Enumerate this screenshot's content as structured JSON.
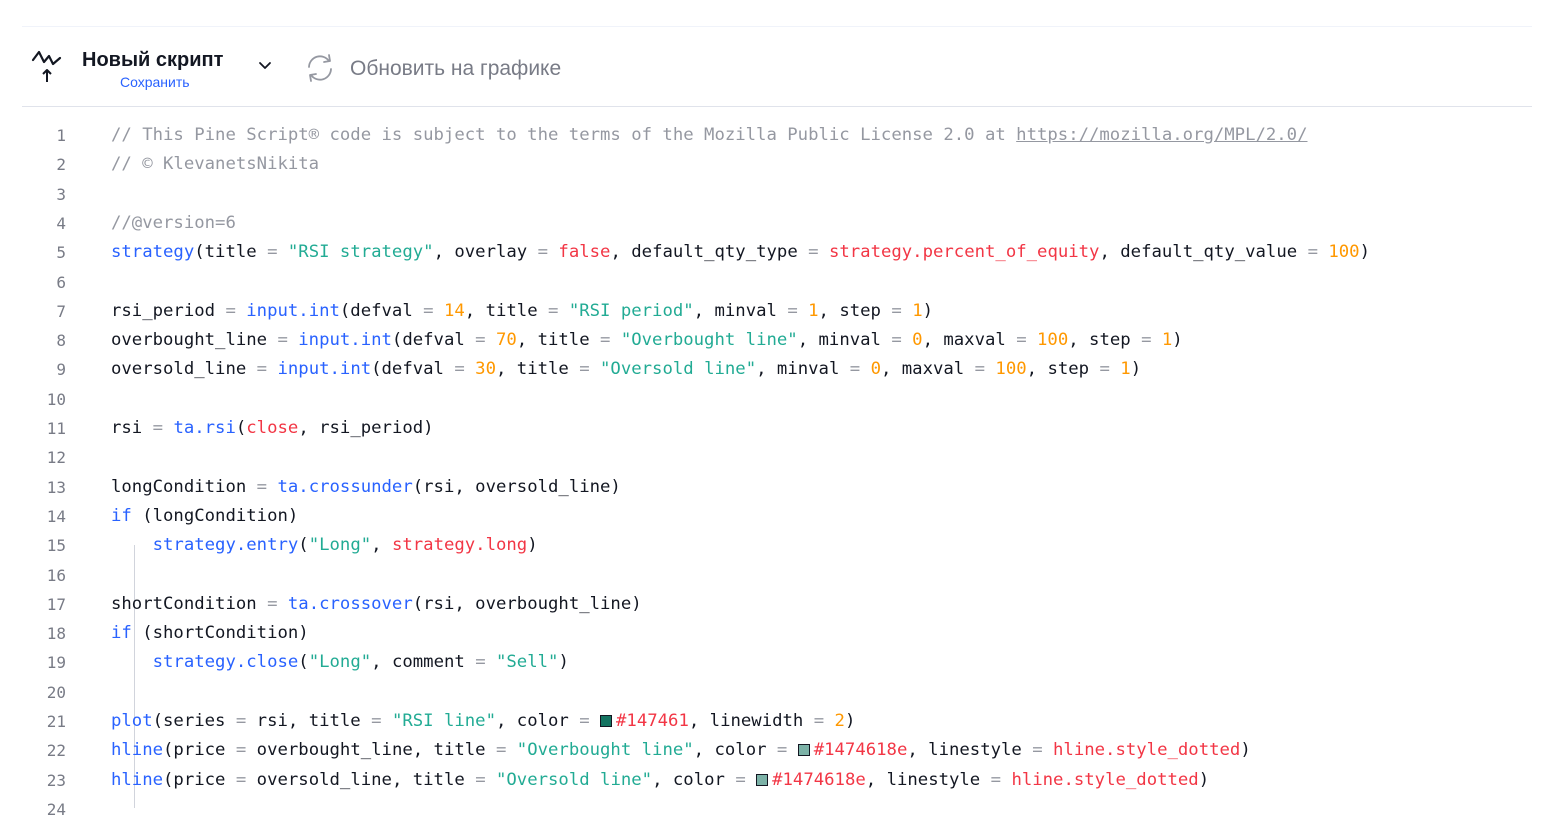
{
  "toolbar": {
    "script_title": "Новый скрипт",
    "save_label": "Сохранить",
    "update_label": "Обновить на графике"
  },
  "icons": {
    "script": "pine-script-icon",
    "dropdown": "chevron-down-icon",
    "refresh": "refresh-icon"
  },
  "colors": {
    "accent": "#2962ff",
    "comment": "#9598a1",
    "string": "#22ab94",
    "number": "#ff9800",
    "keyword": "#f23645",
    "line_color_swatch": "#147461",
    "hline_color_swatch": "#1474618e"
  },
  "editor": {
    "lines": [
      [
        [
          "c",
          "// This Pine Script® code is subject to the terms of the Mozilla Public License 2.0 at "
        ],
        [
          "u",
          "https://mozilla.org/MPL/2.0/"
        ]
      ],
      [
        [
          "c",
          "// © KlevanetsNikita"
        ]
      ],
      [],
      [
        [
          "c",
          "//@version=6"
        ]
      ],
      [
        [
          "f",
          "strategy"
        ],
        [
          "p",
          "(title "
        ],
        [
          "o",
          "="
        ],
        [
          "p",
          " "
        ],
        [
          "s",
          "\"RSI strategy\""
        ],
        [
          "p",
          ", overlay "
        ],
        [
          "o",
          "="
        ],
        [
          "p",
          " "
        ],
        [
          "k",
          "false"
        ],
        [
          "p",
          ", default_qty_type "
        ],
        [
          "o",
          "="
        ],
        [
          "p",
          " "
        ],
        [
          "k",
          "strategy.percent_of_equity"
        ],
        [
          "p",
          ", default_qty_value "
        ],
        [
          "o",
          "="
        ],
        [
          "p",
          " "
        ],
        [
          "n",
          "100"
        ],
        [
          "p",
          ")"
        ]
      ],
      [],
      [
        [
          "p",
          "rsi_period "
        ],
        [
          "o",
          "="
        ],
        [
          "p",
          " "
        ],
        [
          "f",
          "input.int"
        ],
        [
          "p",
          "(defval "
        ],
        [
          "o",
          "="
        ],
        [
          "p",
          " "
        ],
        [
          "n",
          "14"
        ],
        [
          "p",
          ", title "
        ],
        [
          "o",
          "="
        ],
        [
          "p",
          " "
        ],
        [
          "s",
          "\"RSI period\""
        ],
        [
          "p",
          ", minval "
        ],
        [
          "o",
          "="
        ],
        [
          "p",
          " "
        ],
        [
          "n",
          "1"
        ],
        [
          "p",
          ", step "
        ],
        [
          "o",
          "="
        ],
        [
          "p",
          " "
        ],
        [
          "n",
          "1"
        ],
        [
          "p",
          ")"
        ]
      ],
      [
        [
          "p",
          "overbought_line "
        ],
        [
          "o",
          "="
        ],
        [
          "p",
          " "
        ],
        [
          "f",
          "input.int"
        ],
        [
          "p",
          "(defval "
        ],
        [
          "o",
          "="
        ],
        [
          "p",
          " "
        ],
        [
          "n",
          "70"
        ],
        [
          "p",
          ", title "
        ],
        [
          "o",
          "="
        ],
        [
          "p",
          " "
        ],
        [
          "s",
          "\"Overbought line\""
        ],
        [
          "p",
          ", minval "
        ],
        [
          "o",
          "="
        ],
        [
          "p",
          " "
        ],
        [
          "n",
          "0"
        ],
        [
          "p",
          ", maxval "
        ],
        [
          "o",
          "="
        ],
        [
          "p",
          " "
        ],
        [
          "n",
          "100"
        ],
        [
          "p",
          ", step "
        ],
        [
          "o",
          "="
        ],
        [
          "p",
          " "
        ],
        [
          "n",
          "1"
        ],
        [
          "p",
          ")"
        ]
      ],
      [
        [
          "p",
          "oversold_line "
        ],
        [
          "o",
          "="
        ],
        [
          "p",
          " "
        ],
        [
          "f",
          "input.int"
        ],
        [
          "p",
          "(defval "
        ],
        [
          "o",
          "="
        ],
        [
          "p",
          " "
        ],
        [
          "n",
          "30"
        ],
        [
          "p",
          ", title "
        ],
        [
          "o",
          "="
        ],
        [
          "p",
          " "
        ],
        [
          "s",
          "\"Oversold line\""
        ],
        [
          "p",
          ", minval "
        ],
        [
          "o",
          "="
        ],
        [
          "p",
          " "
        ],
        [
          "n",
          "0"
        ],
        [
          "p",
          ", maxval "
        ],
        [
          "o",
          "="
        ],
        [
          "p",
          " "
        ],
        [
          "n",
          "100"
        ],
        [
          "p",
          ", step "
        ],
        [
          "o",
          "="
        ],
        [
          "p",
          " "
        ],
        [
          "n",
          "1"
        ],
        [
          "p",
          ")"
        ]
      ],
      [],
      [
        [
          "p",
          "rsi "
        ],
        [
          "o",
          "="
        ],
        [
          "p",
          " "
        ],
        [
          "f",
          "ta.rsi"
        ],
        [
          "p",
          "("
        ],
        [
          "k",
          "close"
        ],
        [
          "p",
          ", rsi_period)"
        ]
      ],
      [],
      [
        [
          "p",
          "longCondition "
        ],
        [
          "o",
          "="
        ],
        [
          "p",
          " "
        ],
        [
          "f",
          "ta.crossunder"
        ],
        [
          "p",
          "(rsi, oversold_line)"
        ]
      ],
      [
        [
          "f",
          "if"
        ],
        [
          "p",
          " (longCondition)"
        ]
      ],
      [
        [
          "p",
          "    "
        ],
        [
          "f",
          "strategy.entry"
        ],
        [
          "p",
          "("
        ],
        [
          "s",
          "\"Long\""
        ],
        [
          "p",
          ", "
        ],
        [
          "k",
          "strategy.long"
        ],
        [
          "p",
          ")"
        ]
      ],
      [],
      [
        [
          "p",
          "shortCondition "
        ],
        [
          "o",
          "="
        ],
        [
          "p",
          " "
        ],
        [
          "f",
          "ta.crossover"
        ],
        [
          "p",
          "(rsi, overbought_line)"
        ]
      ],
      [
        [
          "f",
          "if"
        ],
        [
          "p",
          " (shortCondition)"
        ]
      ],
      [
        [
          "p",
          "    "
        ],
        [
          "f",
          "strategy.close"
        ],
        [
          "p",
          "("
        ],
        [
          "s",
          "\"Long\""
        ],
        [
          "p",
          ", comment "
        ],
        [
          "o",
          "="
        ],
        [
          "p",
          " "
        ],
        [
          "s",
          "\"Sell\""
        ],
        [
          "p",
          ")"
        ]
      ],
      [],
      [
        [
          "f",
          "plot"
        ],
        [
          "p",
          "(series "
        ],
        [
          "o",
          "="
        ],
        [
          "p",
          " rsi, title "
        ],
        [
          "o",
          "="
        ],
        [
          "p",
          " "
        ],
        [
          "s",
          "\"RSI line\""
        ],
        [
          "p",
          ", color "
        ],
        [
          "o",
          "="
        ],
        [
          "p",
          " "
        ],
        [
          "w",
          "#147461"
        ],
        [
          "k",
          "#147461"
        ],
        [
          "p",
          ", linewidth "
        ],
        [
          "o",
          "="
        ],
        [
          "p",
          " "
        ],
        [
          "n",
          "2"
        ],
        [
          "p",
          ")"
        ]
      ],
      [
        [
          "f",
          "hline"
        ],
        [
          "p",
          "(price "
        ],
        [
          "o",
          "="
        ],
        [
          "p",
          " overbought_line, title "
        ],
        [
          "o",
          "="
        ],
        [
          "p",
          " "
        ],
        [
          "s",
          "\"Overbought line\""
        ],
        [
          "p",
          ", color "
        ],
        [
          "o",
          "="
        ],
        [
          "p",
          " "
        ],
        [
          "w",
          "#1474618e"
        ],
        [
          "k",
          "#1474618e"
        ],
        [
          "p",
          ", linestyle "
        ],
        [
          "o",
          "="
        ],
        [
          "p",
          " "
        ],
        [
          "k",
          "hline.style_dotted"
        ],
        [
          "p",
          ")"
        ]
      ],
      [
        [
          "f",
          "hline"
        ],
        [
          "p",
          "(price "
        ],
        [
          "o",
          "="
        ],
        [
          "p",
          " oversold_line, title "
        ],
        [
          "o",
          "="
        ],
        [
          "p",
          " "
        ],
        [
          "s",
          "\"Oversold line\""
        ],
        [
          "p",
          ", color "
        ],
        [
          "o",
          "="
        ],
        [
          "p",
          " "
        ],
        [
          "w",
          "#1474618e"
        ],
        [
          "k",
          "#1474618e"
        ],
        [
          "p",
          ", linestyle "
        ],
        [
          "o",
          "="
        ],
        [
          "p",
          " "
        ],
        [
          "k",
          "hline.style_dotted"
        ],
        [
          "p",
          ")"
        ]
      ],
      []
    ]
  }
}
